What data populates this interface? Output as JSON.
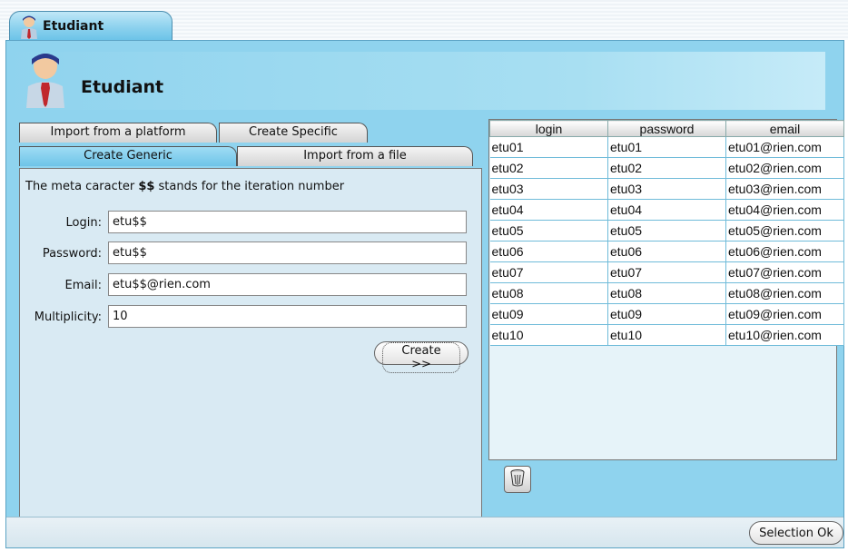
{
  "main_tab": {
    "label": "Etudiant",
    "icon": "user-icon"
  },
  "header": {
    "title": "Etudiant",
    "icon": "user-icon"
  },
  "subtabs": {
    "import_platform": "Import from a platform",
    "create_specific": "Create Specific",
    "create_generic": "Create Generic",
    "import_file": "Import from a file"
  },
  "form": {
    "hint_prefix": "The meta caracter ",
    "hint_meta": "$$",
    "hint_suffix": " stands for the iteration number",
    "login_label": "Login:",
    "login_value": "etu$$",
    "password_label": "Password:",
    "password_value": "etu$$",
    "email_label": "Email:",
    "email_value": "etu$$@rien.com",
    "multiplicity_label": "Multiplicity:",
    "multiplicity_value": "10",
    "create_button": "Create >>"
  },
  "table": {
    "columns": [
      "login",
      "password",
      "email"
    ],
    "rows": [
      [
        "etu01",
        "etu01",
        "etu01@rien.com"
      ],
      [
        "etu02",
        "etu02",
        "etu02@rien.com"
      ],
      [
        "etu03",
        "etu03",
        "etu03@rien.com"
      ],
      [
        "etu04",
        "etu04",
        "etu04@rien.com"
      ],
      [
        "etu05",
        "etu05",
        "etu05@rien.com"
      ],
      [
        "etu06",
        "etu06",
        "etu06@rien.com"
      ],
      [
        "etu07",
        "etu07",
        "etu07@rien.com"
      ],
      [
        "etu08",
        "etu08",
        "etu08@rien.com"
      ],
      [
        "etu09",
        "etu09",
        "etu09@rien.com"
      ],
      [
        "etu10",
        "etu10",
        "etu10@rien.com"
      ]
    ]
  },
  "delete_button": {
    "icon": "trash-icon"
  },
  "selection_ok_button": "Selection Ok",
  "colors": {
    "accent": "#8fd3ee",
    "tab_active": "#6ec4e8",
    "panel": "#d9eaf3"
  }
}
